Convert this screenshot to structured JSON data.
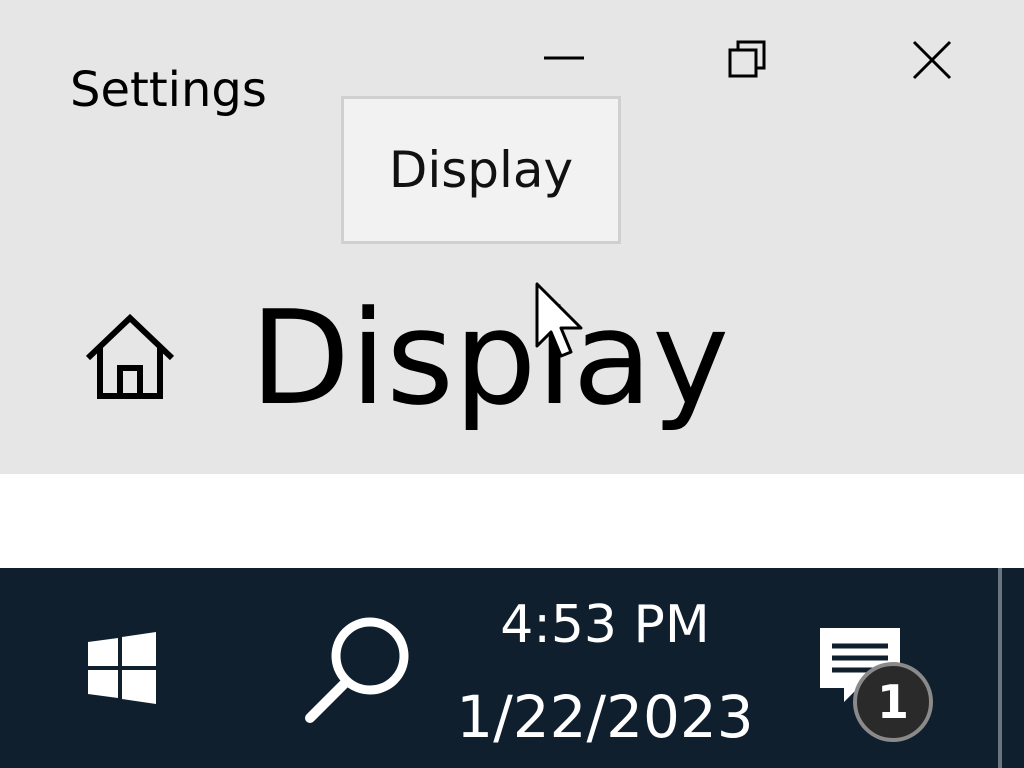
{
  "window": {
    "app_title": "Settings",
    "tooltip": "Display",
    "page_title": "Display"
  },
  "taskbar": {
    "time": "4:53 PM",
    "date": "1/22/2023",
    "notification_count": "1"
  },
  "icons": {
    "minimize": "minimize-icon",
    "maximize": "restore-icon",
    "close": "close-icon",
    "home": "home-icon",
    "start": "windows-logo-icon",
    "search": "search-icon",
    "notifications": "action-center-icon"
  },
  "colors": {
    "window_bg": "#e6e6e6",
    "taskbar_bg": "#0f1f2e",
    "tooltip_bg": "#f2f2f2"
  }
}
